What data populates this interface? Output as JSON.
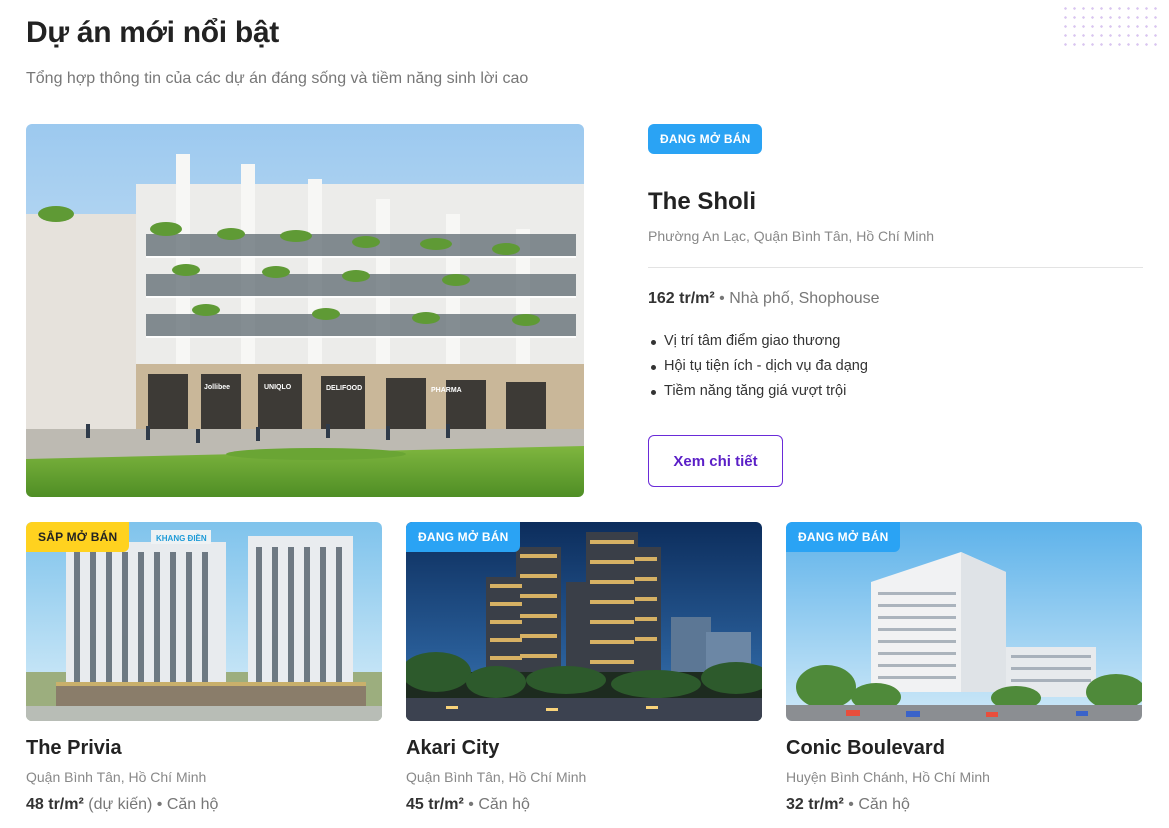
{
  "section": {
    "title": "Dự án mới nổi bật",
    "subtitle": "Tổng hợp thông tin của các dự án đáng sống và tiềm năng sinh lời cao"
  },
  "featured": {
    "badge": "ĐANG MỞ BÁN",
    "name": "The Sholi",
    "address": "Phường An Lạc, Quận Bình Tân, Hồ Chí Minh",
    "price": "162 tr/m²",
    "separator": "•",
    "type": "Nhà phố, Shophouse",
    "highlights": [
      "Vị trí tâm điểm giao thương",
      "Hội tụ tiện ích - dịch vụ đa dạng",
      "Tiềm năng tăng giá vượt trội"
    ],
    "button": "Xem chi tiết",
    "storefront_signs": [
      "Jollibee",
      "UNIQLO",
      "DELIFOOD",
      "PHARMA"
    ]
  },
  "projects": [
    {
      "badge": "SẮP MỞ BÁN",
      "name": "The Privia",
      "address": "Quận Bình Tân, Hồ Chí Minh",
      "price": "48 tr/m²",
      "price_note": "(dự kiến)",
      "separator": "•",
      "type": "Căn hộ",
      "image_sign": "KHANG ĐIỀN"
    },
    {
      "badge": "ĐANG MỞ BÁN",
      "name": "Akari City",
      "address": "Quận Bình Tân, Hồ Chí Minh",
      "price": "45 tr/m²",
      "price_note": "",
      "separator": "•",
      "type": "Căn hộ"
    },
    {
      "badge": "ĐANG MỞ BÁN",
      "name": "Conic Boulevard",
      "address": "Huyện Bình Chánh, Hồ Chí Minh",
      "price": "32 tr/m²",
      "price_note": "",
      "separator": "•",
      "type": "Căn hộ"
    }
  ],
  "colors": {
    "badge_open": "#2aa3f4",
    "badge_soon": "#ffd21f",
    "button_border": "#6a2bd8",
    "title": "#222222",
    "muted": "#888888"
  }
}
